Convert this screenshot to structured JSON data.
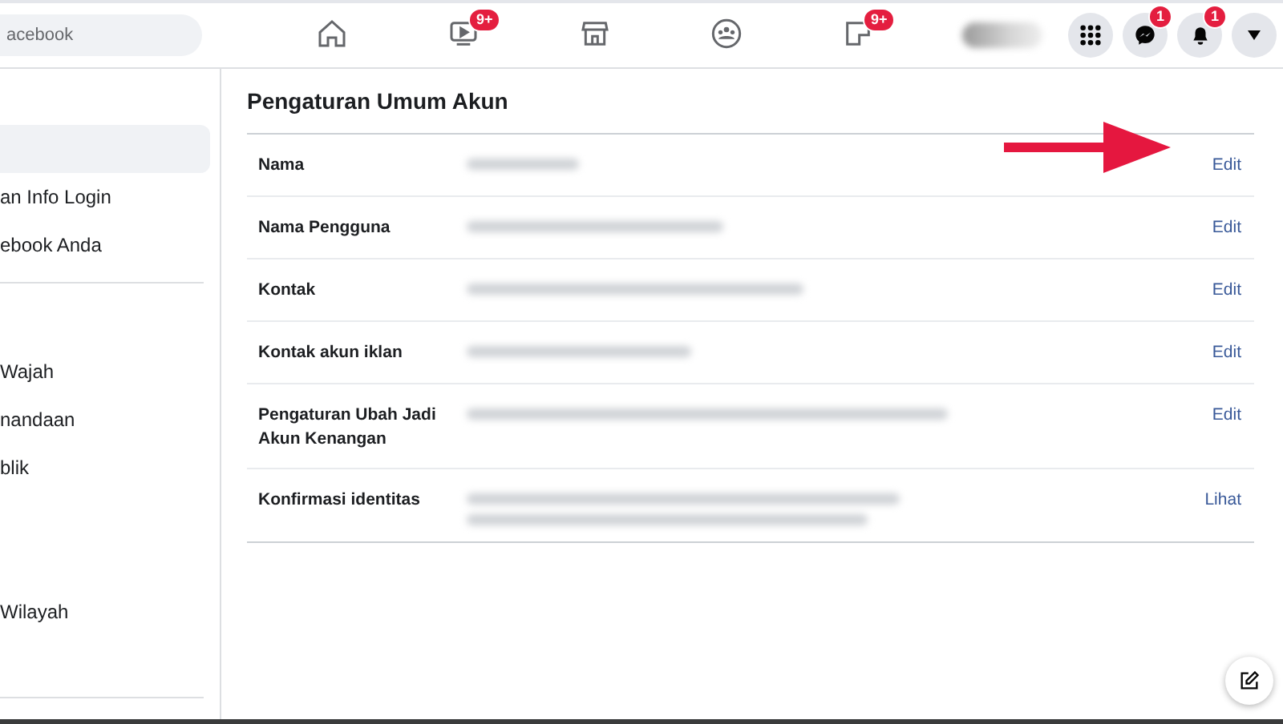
{
  "topbar": {
    "search": {
      "placeholder": "acebook"
    },
    "nav": [
      {
        "kind": "home",
        "selected": false
      },
      {
        "kind": "video",
        "badge": "9+",
        "selected": false
      },
      {
        "kind": "store",
        "selected": false
      },
      {
        "kind": "groups",
        "selected": false
      },
      {
        "kind": "gaming",
        "badge": "9+",
        "selected": false
      }
    ],
    "actions": [
      {
        "kind": "grid"
      },
      {
        "kind": "messenger",
        "badge": "1"
      },
      {
        "kind": "bell",
        "badge": "1"
      },
      {
        "kind": "caret"
      }
    ]
  },
  "sidebar": {
    "sections": [
      {
        "items": [
          {
            "kind": "item",
            "selected": true
          },
          {
            "kind": "item",
            "label": "an Info Login",
            "selected": false
          },
          {
            "kind": "item",
            "label": "ebook Anda",
            "selected": false
          }
        ]
      },
      {
        "items": [
          {
            "kind": "blank"
          },
          {
            "kind": "item",
            "label": "Wajah",
            "selected": false
          },
          {
            "kind": "item",
            "label": "nandaan",
            "selected": false
          },
          {
            "kind": "item",
            "label": "blik",
            "selected": false
          },
          {
            "kind": "blank"
          },
          {
            "kind": "blank"
          },
          {
            "kind": "item",
            "label": "Wilayah",
            "selected": false
          },
          {
            "kind": "blank"
          }
        ]
      }
    ]
  },
  "settings": {
    "title": "Pengaturan Umum Akun",
    "rows": [
      {
        "label": "Nama",
        "action": "Edit",
        "arrow": true
      },
      {
        "label": "Nama Pengguna",
        "action": "Edit",
        "arrow": false
      },
      {
        "label": "Kontak",
        "action": "Edit",
        "arrow": false
      },
      {
        "label": "Kontak akun iklan",
        "action": "Edit",
        "arrow": false
      },
      {
        "label": "Pengaturan Ubah Jadi Akun Kenangan",
        "action": "Edit",
        "arrow": false
      },
      {
        "label": "Konfirmasi identitas",
        "action": "Lihat",
        "arrow": false
      }
    ]
  }
}
